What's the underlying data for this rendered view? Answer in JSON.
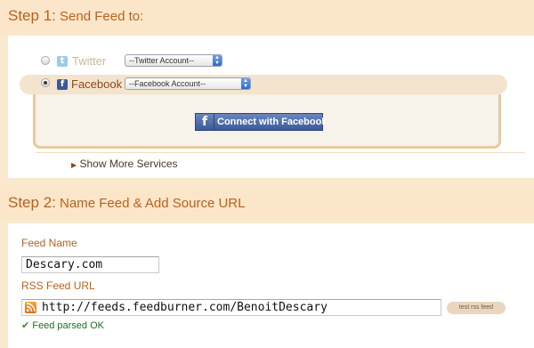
{
  "step1": {
    "step_label": "Step 1:",
    "title": "Send Feed to:"
  },
  "services": [
    {
      "name": "Twitter",
      "account_select": "--Twitter Account--",
      "selected": false,
      "icon": "twitter-icon"
    },
    {
      "name": "Facebook",
      "account_select": "--Facebook Account--",
      "selected": true,
      "icon": "facebook-icon"
    }
  ],
  "connect_button": {
    "label": "Connect with Facebook",
    "icon": "f"
  },
  "show_more": {
    "label": "Show More Services",
    "icon": "▶"
  },
  "step2": {
    "step_label": "Step 2:",
    "title": "Name Feed & Add Source URL"
  },
  "feed_name": {
    "label": "Feed Name",
    "value": "Descary.com"
  },
  "rss_url": {
    "label": "RSS Feed URL",
    "value": "http://feeds.feedburner.com/BenoitDescary",
    "icon": "rss-icon"
  },
  "test_button": {
    "label": "test rss feed"
  },
  "status": {
    "text": "Feed parsed OK",
    "icon": "checkmark-icon"
  },
  "colors": {
    "accent": "#b8621e",
    "background": "#fbe9cf",
    "facebook": "#3b5998",
    "success": "#1f6e1f"
  }
}
